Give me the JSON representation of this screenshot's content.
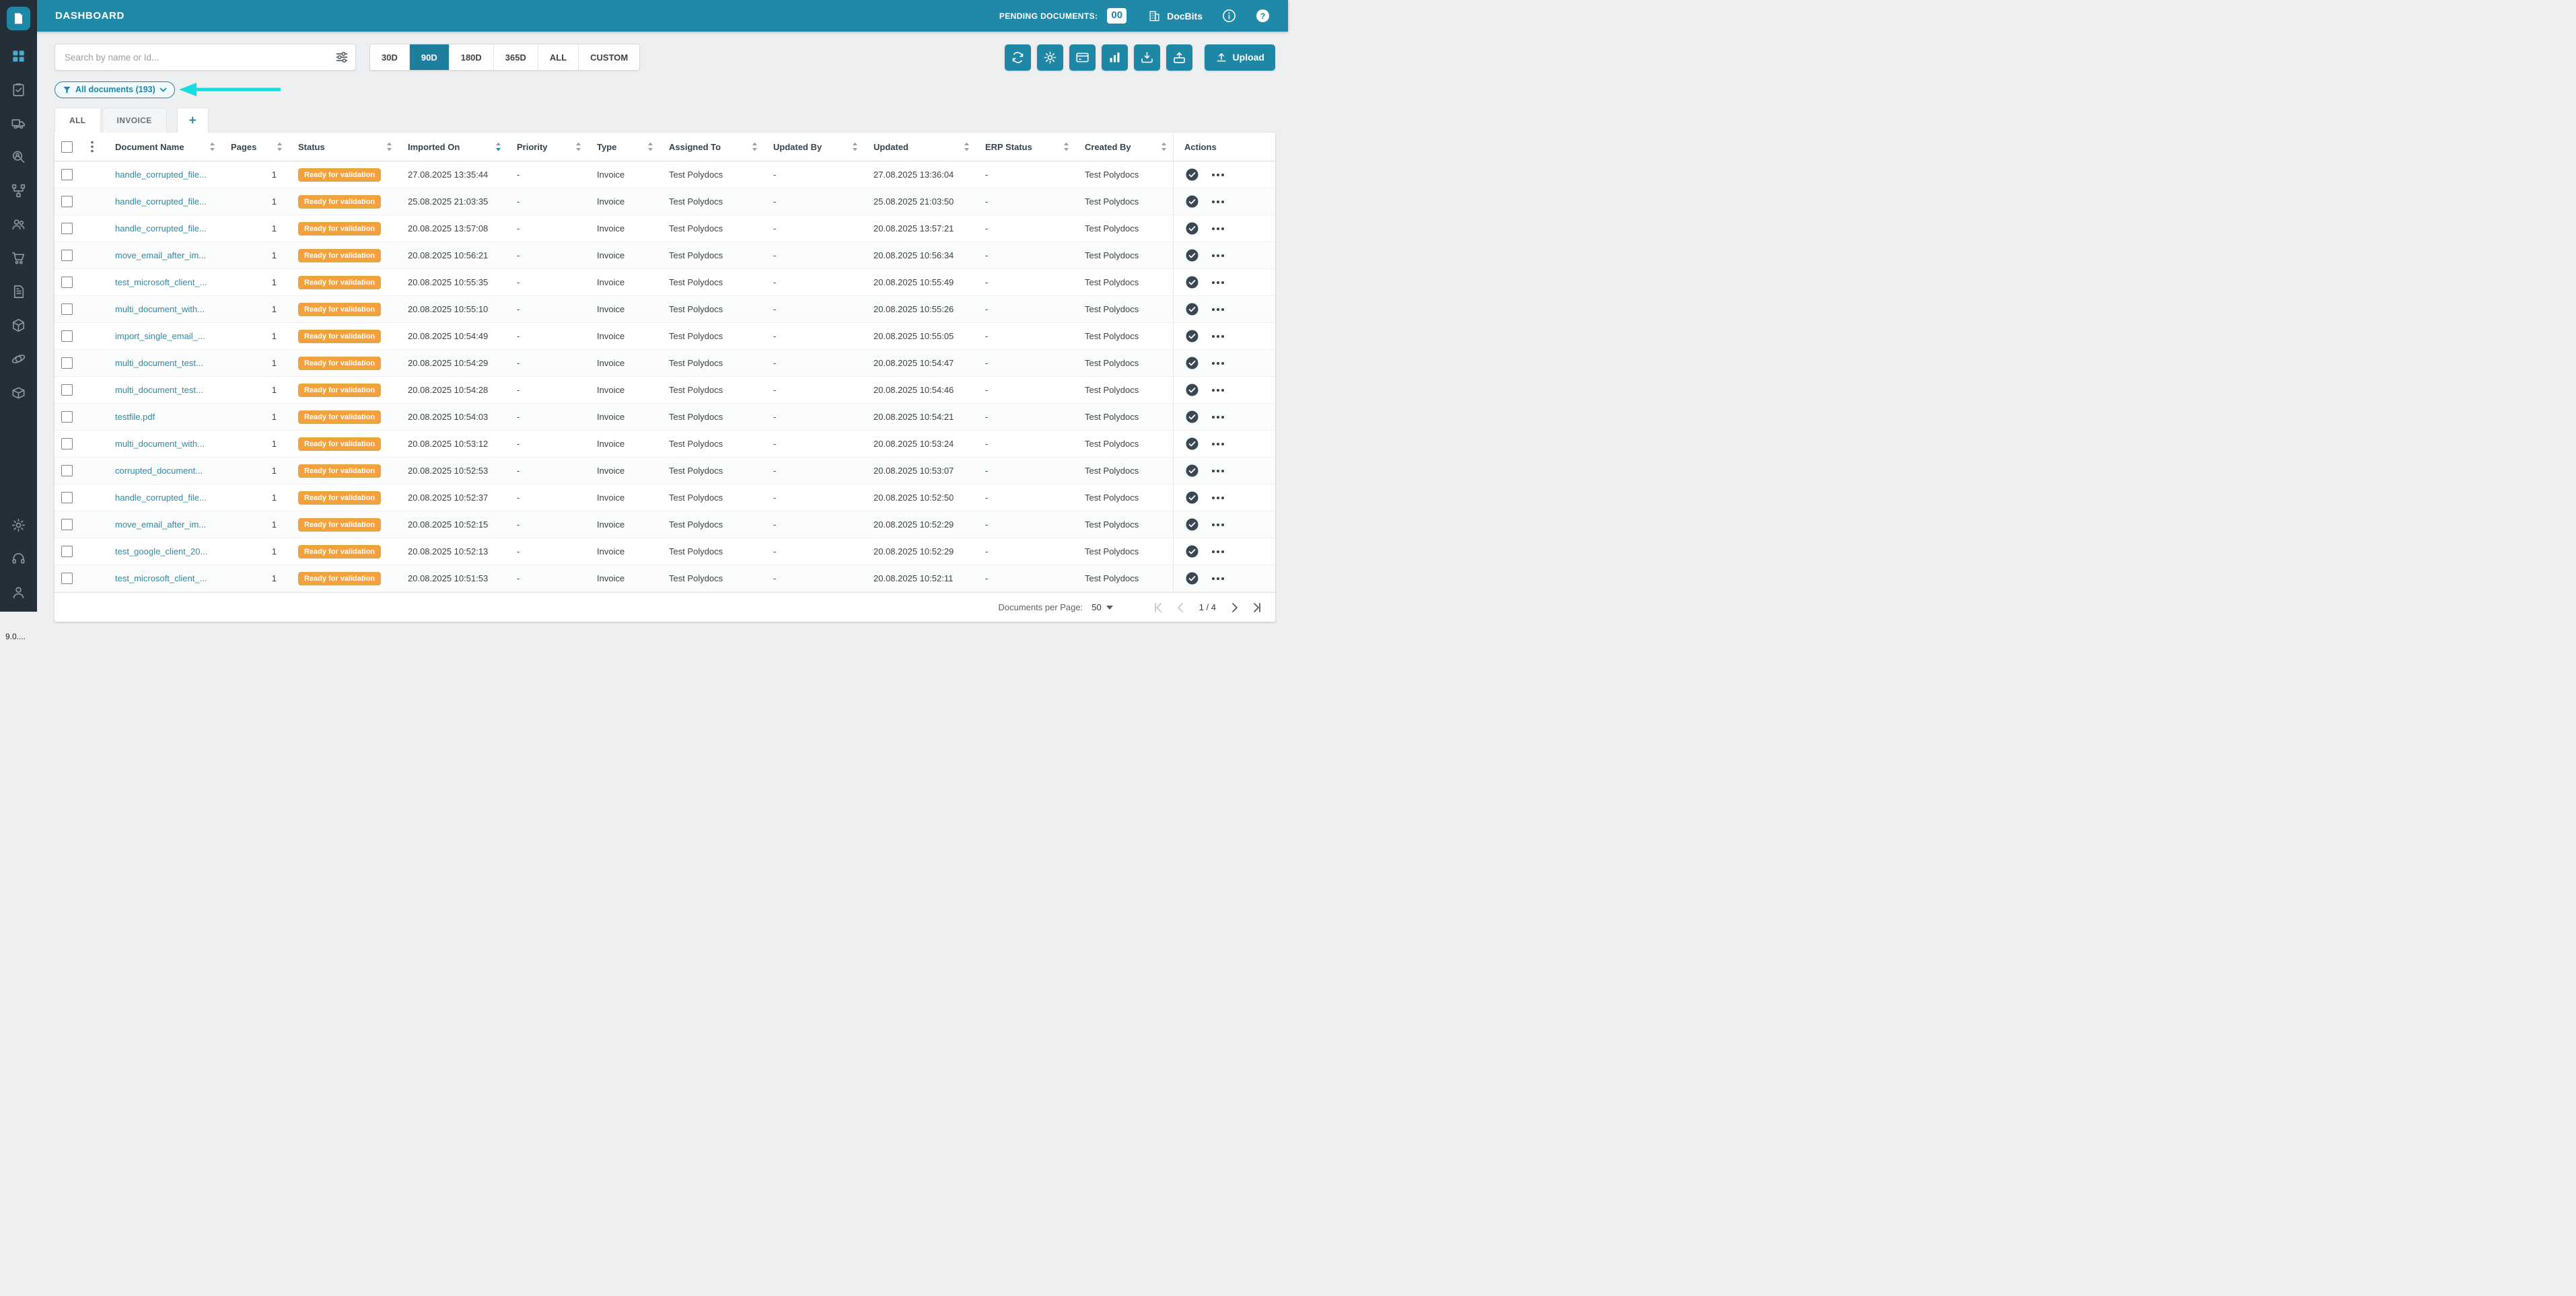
{
  "colors": {
    "topbar": "#2189a8",
    "accent": "#1f87a6",
    "sidebar": "#242f39",
    "badge": "#f2a23c",
    "link": "#2b8ca9",
    "annotation": "#14dee0"
  },
  "topbar": {
    "title": "DASHBOARD",
    "pending_label": "PENDING DOCUMENTS:",
    "pending_count": "00",
    "brand": "DocBits"
  },
  "sidebar": {
    "icons": [
      "docbits-logo",
      "dashboard",
      "tasks",
      "shipments",
      "user-search",
      "workflow",
      "team",
      "purchases",
      "invoices",
      "packages",
      "integrations",
      "products",
      "settings",
      "support",
      "account"
    ],
    "version": "9.0...."
  },
  "toolbar": {
    "search_placeholder": "Search by name or Id...",
    "time_filters": [
      "30D",
      "90D",
      "180D",
      "365D",
      "ALL",
      "CUSTOM"
    ],
    "active_time_filter": "90D",
    "action_icons": [
      "refresh",
      "settings",
      "payment-card",
      "analytics",
      "mail-import",
      "box-export"
    ],
    "upload_label": "Upload"
  },
  "filter_chip": {
    "label": "All documents (193)"
  },
  "tabs": {
    "items": [
      "ALL",
      "INVOICE"
    ],
    "add_label": "+"
  },
  "table": {
    "columns": [
      "Document Name",
      "Pages",
      "Status",
      "Imported On",
      "Priority",
      "Type",
      "Assigned To",
      "Updated By",
      "Updated",
      "ERP Status",
      "Created By",
      "Actions"
    ],
    "sorted_column": "Imported On",
    "rows": [
      {
        "name": "handle_corrupted_file...",
        "pages": "1",
        "status": "Ready for validation",
        "imported": "27.08.2025 13:35:44",
        "priority": "-",
        "type": "Invoice",
        "assigned": "Test Polydocs",
        "updated_by": "-",
        "updated": "27.08.2025 13:36:04",
        "erp": "-",
        "created_by": "Test Polydocs"
      },
      {
        "name": "handle_corrupted_file...",
        "pages": "1",
        "status": "Ready for validation",
        "imported": "25.08.2025 21:03:35",
        "priority": "-",
        "type": "Invoice",
        "assigned": "Test Polydocs",
        "updated_by": "-",
        "updated": "25.08.2025 21:03:50",
        "erp": "-",
        "created_by": "Test Polydocs"
      },
      {
        "name": "handle_corrupted_file...",
        "pages": "1",
        "status": "Ready for validation",
        "imported": "20.08.2025 13:57:08",
        "priority": "-",
        "type": "Invoice",
        "assigned": "Test Polydocs",
        "updated_by": "-",
        "updated": "20.08.2025 13:57:21",
        "erp": "-",
        "created_by": "Test Polydocs"
      },
      {
        "name": "move_email_after_im...",
        "pages": "1",
        "status": "Ready for validation",
        "imported": "20.08.2025 10:56:21",
        "priority": "-",
        "type": "Invoice",
        "assigned": "Test Polydocs",
        "updated_by": "-",
        "updated": "20.08.2025 10:56:34",
        "erp": "-",
        "created_by": "Test Polydocs"
      },
      {
        "name": "test_microsoft_client_...",
        "pages": "1",
        "status": "Ready for validation",
        "imported": "20.08.2025 10:55:35",
        "priority": "-",
        "type": "Invoice",
        "assigned": "Test Polydocs",
        "updated_by": "-",
        "updated": "20.08.2025 10:55:49",
        "erp": "-",
        "created_by": "Test Polydocs"
      },
      {
        "name": "multi_document_with...",
        "pages": "1",
        "status": "Ready for validation",
        "imported": "20.08.2025 10:55:10",
        "priority": "-",
        "type": "Invoice",
        "assigned": "Test Polydocs",
        "updated_by": "-",
        "updated": "20.08.2025 10:55:26",
        "erp": "-",
        "created_by": "Test Polydocs"
      },
      {
        "name": "import_single_email_...",
        "pages": "1",
        "status": "Ready for validation",
        "imported": "20.08.2025 10:54:49",
        "priority": "-",
        "type": "Invoice",
        "assigned": "Test Polydocs",
        "updated_by": "-",
        "updated": "20.08.2025 10:55:05",
        "erp": "-",
        "created_by": "Test Polydocs"
      },
      {
        "name": "multi_document_test...",
        "pages": "1",
        "status": "Ready for validation",
        "imported": "20.08.2025 10:54:29",
        "priority": "-",
        "type": "Invoice",
        "assigned": "Test Polydocs",
        "updated_by": "-",
        "updated": "20.08.2025 10:54:47",
        "erp": "-",
        "created_by": "Test Polydocs"
      },
      {
        "name": "multi_document_test...",
        "pages": "1",
        "status": "Ready for validation",
        "imported": "20.08.2025 10:54:28",
        "priority": "-",
        "type": "Invoice",
        "assigned": "Test Polydocs",
        "updated_by": "-",
        "updated": "20.08.2025 10:54:46",
        "erp": "-",
        "created_by": "Test Polydocs"
      },
      {
        "name": "testfile.pdf",
        "pages": "1",
        "status": "Ready for validation",
        "imported": "20.08.2025 10:54:03",
        "priority": "-",
        "type": "Invoice",
        "assigned": "Test Polydocs",
        "updated_by": "-",
        "updated": "20.08.2025 10:54:21",
        "erp": "-",
        "created_by": "Test Polydocs"
      },
      {
        "name": "multi_document_with...",
        "pages": "1",
        "status": "Ready for validation",
        "imported": "20.08.2025 10:53:12",
        "priority": "-",
        "type": "Invoice",
        "assigned": "Test Polydocs",
        "updated_by": "-",
        "updated": "20.08.2025 10:53:24",
        "erp": "-",
        "created_by": "Test Polydocs"
      },
      {
        "name": "corrupted_document...",
        "pages": "1",
        "status": "Ready for validation",
        "imported": "20.08.2025 10:52:53",
        "priority": "-",
        "type": "Invoice",
        "assigned": "Test Polydocs",
        "updated_by": "-",
        "updated": "20.08.2025 10:53:07",
        "erp": "-",
        "created_by": "Test Polydocs"
      },
      {
        "name": "handle_corrupted_file...",
        "pages": "1",
        "status": "Ready for validation",
        "imported": "20.08.2025 10:52:37",
        "priority": "-",
        "type": "Invoice",
        "assigned": "Test Polydocs",
        "updated_by": "-",
        "updated": "20.08.2025 10:52:50",
        "erp": "-",
        "created_by": "Test Polydocs"
      },
      {
        "name": "move_email_after_im...",
        "pages": "1",
        "status": "Ready for validation",
        "imported": "20.08.2025 10:52:15",
        "priority": "-",
        "type": "Invoice",
        "assigned": "Test Polydocs",
        "updated_by": "-",
        "updated": "20.08.2025 10:52:29",
        "erp": "-",
        "created_by": "Test Polydocs"
      },
      {
        "name": "test_google_client_20...",
        "pages": "1",
        "status": "Ready for validation",
        "imported": "20.08.2025 10:52:13",
        "priority": "-",
        "type": "Invoice",
        "assigned": "Test Polydocs",
        "updated_by": "-",
        "updated": "20.08.2025 10:52:29",
        "erp": "-",
        "created_by": "Test Polydocs"
      },
      {
        "name": "test_microsoft_client_...",
        "pages": "1",
        "status": "Ready for validation",
        "imported": "20.08.2025 10:51:53",
        "priority": "-",
        "type": "Invoice",
        "assigned": "Test Polydocs",
        "updated_by": "-",
        "updated": "20.08.2025 10:52:11",
        "erp": "-",
        "created_by": "Test Polydocs"
      }
    ]
  },
  "pagination": {
    "per_page_label": "Documents per Page:",
    "per_page_value": "50",
    "page_info": "1 / 4"
  }
}
